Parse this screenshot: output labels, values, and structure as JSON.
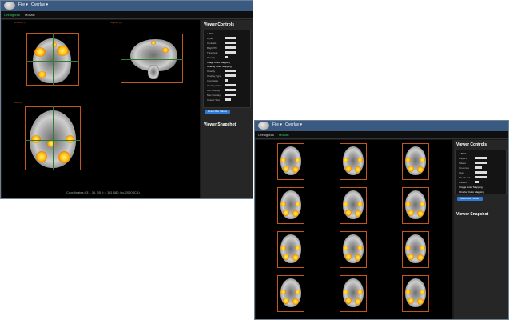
{
  "menus": {
    "file": "File ▾",
    "overlay": "Overlay ▾"
  },
  "tabs": {
    "orthogonal": "Orthogonal",
    "mosaic": "Mosaic"
  },
  "window1": {
    "views": {
      "coronal": "Coronal (Y)",
      "sagittal": "Sagittal (X)",
      "axial": "Axial (Z)"
    },
    "panel_title": "Viewer Controls",
    "controls": {
      "section": "• Main",
      "rows": [
        "Layer",
        "Contrast",
        "Bright/Th",
        "Threshold",
        "Opacity"
      ],
      "section2": "Image Color Mapping",
      "section3": "Overlay Color Mapping",
      "rows2": [
        "Opacity",
        "Overlay Type",
        "Interpolate",
        "Overlay Value",
        "Min Overlay",
        "Max Overlay",
        "Cluster Size"
      ],
      "button": "Reset Max Values"
    },
    "snapshot_title": "Viewer Snapshot",
    "coordinates": "Coordinates: (31, 36, 35) t = 181.080 (no-2000 ICA)"
  },
  "window2": {
    "panel_title": "Viewer Controls",
    "controls": {
      "section": "• Main",
      "rows": [
        "Layers",
        "Slices",
        "Columns",
        "Gap",
        "Rendered",
        "Labels"
      ],
      "section2": "Image Color Mapping",
      "section3": "Overlay Color Mapping",
      "button": "Reset Max Values"
    },
    "snapshot_title": "Viewer Snapshot",
    "mosaic_count": 12
  },
  "colors": {
    "accent_tab": "#3cc86e",
    "topbar": "#3a5a82",
    "activation": "#ffc21a",
    "frame": "#c0581d",
    "button": "#2e7bd6"
  }
}
